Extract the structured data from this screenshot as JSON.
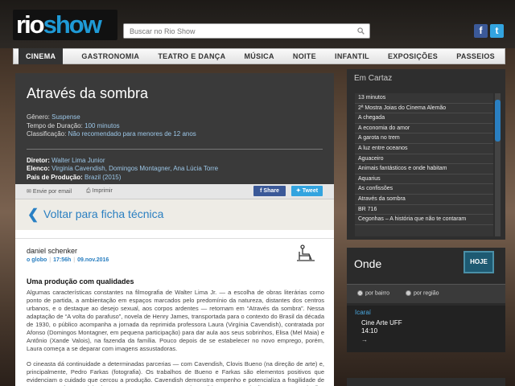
{
  "header": {
    "logo_a": "rio",
    "logo_b": "show",
    "search_placeholder": "Buscar no Rio Show",
    "facebook": "f",
    "twitter": "t"
  },
  "nav": [
    "CINEMA",
    "GASTRONOMIA",
    "TEATRO E DANÇA",
    "MÚSICA",
    "NOITE",
    "INFANTIL",
    "EXPOSIÇÕES",
    "PASSEIOS"
  ],
  "film": {
    "title": "Através da sombra",
    "genre_label": "Gênero:",
    "genre": "Suspense",
    "duration_label": "Tempo de Duração:",
    "duration": "100 minutos",
    "rating_label": "Classificação:",
    "rating": "Não recomendado para menores de 12 anos",
    "director_label": "Diretor:",
    "director": "Walter Lima Junior",
    "cast_label": "Elenco:",
    "cast": "Virginia Cavendish, Domingos Montagner, Ana Lúcia Torre",
    "country_label": "País de Produção:",
    "country": "Brazil (2015)"
  },
  "share": {
    "email": "Envie por email",
    "print": "Imprimir",
    "fb": "Share",
    "tw": "Tweet"
  },
  "back": {
    "label": "Voltar para ficha técnica"
  },
  "article": {
    "author": "daniel schenker",
    "source": "o globo",
    "time": "17:56h",
    "date": "09.nov.2016",
    "title": "Uma produção com qualidades",
    "p1": "Algumas características constantes na filmografia de Walter Lima Jr. — a escolha de obras literárias como ponto de partida, a ambientação em espaços marcados pelo predomínio da natureza, distantes dos centros urbanos, e o destaque ao desejo sexual, aos corpos ardentes — retornam em “Através da sombra”. Nessa adaptação de “A volta do parafuso”, novela de Henry James, transportada para o contexto do Brasil da década de 1930, o público acompanha a jornada da reprimida professora Laura (Virgínia Cavendish), contratada por Afonso (Domingos Montagner, em pequena participação) para dar aula aos seus sobrinhos, Elisa (Mel Maia) e Antônio (Xande Valois), na fazenda da família. Pouco depois de se estabelecer no novo emprego, porém, Laura começa a se deparar com imagens assustadoras.",
    "p2": "O cineasta dá continuidade a determinadas parcerias — com Cavendish, Clovis Bueno (na direção de arte) e, principalmente, Pedro Farkas (fotografia). Os trabalhos de Bueno e Farkas são elementos positivos que evidenciam o cuidado que cercou a produção. Cavendish demonstra empenho e potencializa a fragilidade de Laura, mas é encaminhada para o exagero, crescente à medida que a projeção avança. A atriz fica prejudicada no postiço embate final com Antônio, problema do roteiro"
  },
  "sidebar": {
    "cartaz_title": "Em Cartaz",
    "cartaz": [
      "13 minutos",
      "2ª Mostra Joias do Cinema Alemão",
      "A chegada",
      "A economia do amor",
      "A garota no trem",
      "A luz entre oceanos",
      "Aguaceiro",
      "Animais fantásticos e onde habitam",
      "Aquarius",
      "As confissões",
      "Através da sombra",
      "BR 716",
      "Cegonhas – A história que não te contaram"
    ],
    "onde_title": "Onde",
    "hoje": "HOJE",
    "filter_bairro": "por bairro",
    "filter_regiao": "por região",
    "place_name": "Icaraí",
    "place_venue": "Cine Arte UFF",
    "place_time": "14:10",
    "place_arrow": "→"
  }
}
